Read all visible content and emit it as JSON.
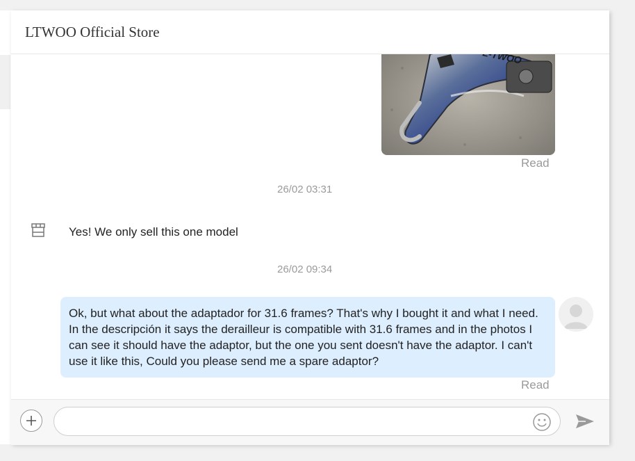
{
  "header": {
    "store_name": "LTWOO Official Store"
  },
  "messages": {
    "image_message": {
      "read_status": "Read"
    },
    "timestamp_1": "26/02 03:31",
    "incoming_text": "Yes! We only sell this one model",
    "timestamp_2": "26/02 09:34",
    "outgoing_text": "Ok, but what about the adaptador for 31.6 frames? That's why I bought it and what I need. In the descripción it says the derailleur is compatible with 31.6 frames and in the photos I can see it should have the adaptor, but the one you sent doesn't have the adaptor. I can't use it like this, Could you please send me a spare adaptor?",
    "outgoing_read_status": "Read"
  },
  "composer": {
    "input_value": "",
    "icons": [
      "plus-icon",
      "emoji-icon",
      "send-icon"
    ]
  },
  "colors": {
    "outgoing_bubble": "#ddeeff",
    "muted_text": "#9a9a9a",
    "product_brand_blue": "#2a3f8f"
  }
}
